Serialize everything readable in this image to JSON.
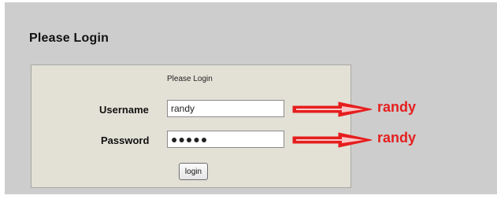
{
  "page": {
    "title": "Please Login"
  },
  "login_form": {
    "caption": "Please Login",
    "username_label": "Username",
    "username_value": "randy",
    "password_label": "Password",
    "password_display": "●●●●●",
    "login_button": "login"
  },
  "annotations": {
    "username_hint": "randy",
    "password_hint": "randy"
  },
  "colors": {
    "panel_background": "#cdcdcd",
    "login_box_background": "#e3e1d6",
    "annotation_red": "#e61e1e"
  },
  "icons": {
    "arrow": "right-arrow-icon"
  }
}
